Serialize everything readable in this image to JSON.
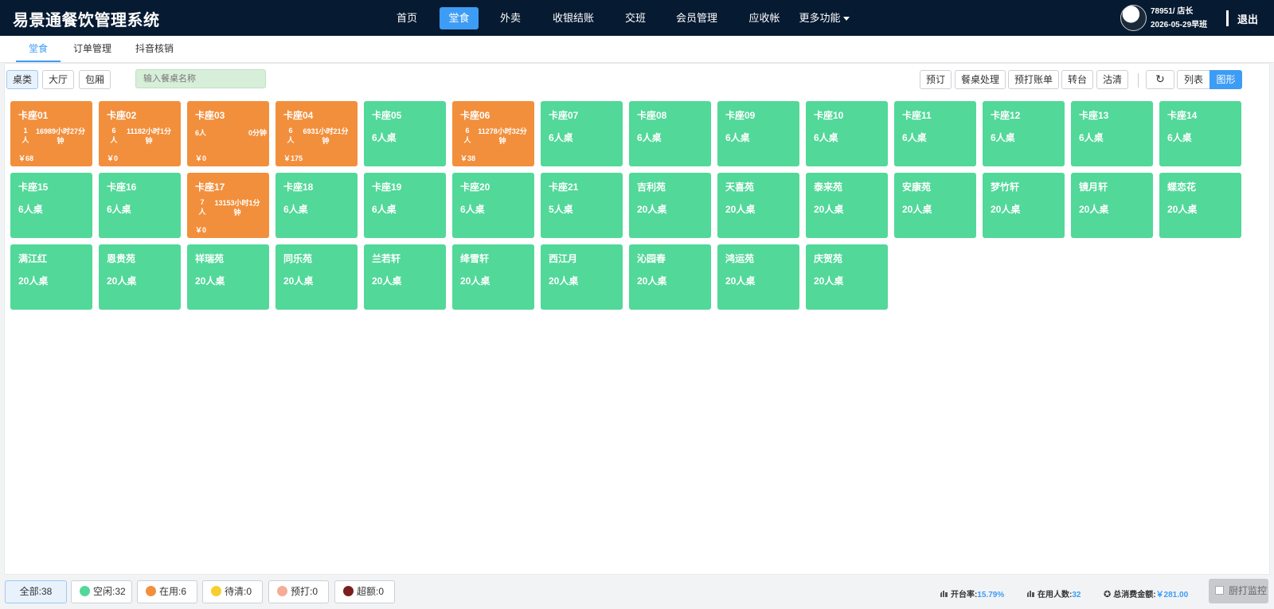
{
  "header": {
    "brand": "易景通餐饮管理系统",
    "nav": [
      {
        "label": "首页"
      },
      {
        "label": "堂食",
        "active": true
      },
      {
        "label": "外卖"
      },
      {
        "label": "收银结账"
      },
      {
        "label": "交班"
      },
      {
        "label": "会员管理"
      },
      {
        "label": "应收帐"
      },
      {
        "label": "更多功能"
      }
    ],
    "user_line1": "78951/ 店长",
    "user_line2": "2026-05-29早班",
    "logout": "退出"
  },
  "subtabs": [
    "堂食",
    "订单管理",
    "抖音核销"
  ],
  "toolbar": {
    "filters": [
      "桌类",
      "大厅",
      "包厢"
    ],
    "search_placeholder": "输入餐桌名称",
    "actions": [
      "预订",
      "餐桌处理",
      "预打账单",
      "转台",
      "沽清"
    ],
    "refresh_icon": "↻",
    "view_list": "列表",
    "view_graphic": "图形"
  },
  "tables": [
    {
      "name": "卡座01",
      "status": "busy",
      "people": "1\n人",
      "duration": "16989小时27分\n钟",
      "amount": "￥68"
    },
    {
      "name": "卡座02",
      "status": "busy",
      "people": "6\n人",
      "duration": "11182小时1分\n钟",
      "amount": "￥0"
    },
    {
      "name": "卡座03",
      "status": "busy",
      "people": "6人",
      "duration": "0分钟",
      "amount": "￥0",
      "inline": true
    },
    {
      "name": "卡座04",
      "status": "busy",
      "people": "6\n人",
      "duration": "6931小时21分\n钟",
      "amount": "￥175"
    },
    {
      "name": "卡座05",
      "status": "free",
      "capacity": "6人桌"
    },
    {
      "name": "卡座06",
      "status": "busy",
      "people": "6\n人",
      "duration": "11278小时32分\n钟",
      "amount": "￥38"
    },
    {
      "name": "卡座07",
      "status": "free",
      "capacity": "6人桌"
    },
    {
      "name": "卡座08",
      "status": "free",
      "capacity": "6人桌"
    },
    {
      "name": "卡座09",
      "status": "free",
      "capacity": "6人桌"
    },
    {
      "name": "卡座10",
      "status": "free",
      "capacity": "6人桌"
    },
    {
      "name": "卡座11",
      "status": "free",
      "capacity": "6人桌"
    },
    {
      "name": "卡座12",
      "status": "free",
      "capacity": "6人桌"
    },
    {
      "name": "卡座13",
      "status": "free",
      "capacity": "6人桌"
    },
    {
      "name": "卡座14",
      "status": "free",
      "capacity": "6人桌"
    },
    {
      "name": "卡座15",
      "status": "free",
      "capacity": "6人桌"
    },
    {
      "name": "卡座16",
      "status": "free",
      "capacity": "6人桌"
    },
    {
      "name": "卡座17",
      "status": "busy",
      "people": "7\n人",
      "duration": "13153小时1分\n钟",
      "amount": "￥0"
    },
    {
      "name": "卡座18",
      "status": "free",
      "capacity": "6人桌"
    },
    {
      "name": "卡座19",
      "status": "free",
      "capacity": "6人桌"
    },
    {
      "name": "卡座20",
      "status": "free",
      "capacity": "6人桌"
    },
    {
      "name": "卡座21",
      "status": "free",
      "capacity": "5人桌"
    },
    {
      "name": "吉利苑",
      "status": "free",
      "capacity": "20人桌"
    },
    {
      "name": "天喜苑",
      "status": "free",
      "capacity": "20人桌"
    },
    {
      "name": "泰来苑",
      "status": "free",
      "capacity": "20人桌"
    },
    {
      "name": "安康苑",
      "status": "free",
      "capacity": "20人桌"
    },
    {
      "name": "梦竹轩",
      "status": "free",
      "capacity": "20人桌"
    },
    {
      "name": "镜月轩",
      "status": "free",
      "capacity": "20人桌"
    },
    {
      "name": "蝶恋花",
      "status": "free",
      "capacity": "20人桌"
    },
    {
      "name": "满江红",
      "status": "free",
      "capacity": "20人桌"
    },
    {
      "name": "恩贵苑",
      "status": "free",
      "capacity": "20人桌"
    },
    {
      "name": "祥瑞苑",
      "status": "free",
      "capacity": "20人桌"
    },
    {
      "name": "同乐苑",
      "status": "free",
      "capacity": "20人桌"
    },
    {
      "name": "兰若轩",
      "status": "free",
      "capacity": "20人桌"
    },
    {
      "name": "绛雪轩",
      "status": "free",
      "capacity": "20人桌"
    },
    {
      "name": "西江月",
      "status": "free",
      "capacity": "20人桌"
    },
    {
      "name": "沁园春",
      "status": "free",
      "capacity": "20人桌"
    },
    {
      "name": "鸿运苑",
      "status": "free",
      "capacity": "20人桌"
    },
    {
      "name": "庆贺苑",
      "status": "free",
      "capacity": "20人桌"
    }
  ],
  "footer": {
    "chips": [
      {
        "label": "全部:38",
        "active": true
      },
      {
        "label": "空闲:32",
        "color": "#52d899"
      },
      {
        "label": "在用:6",
        "color": "#f28f3c"
      },
      {
        "label": "待清:0",
        "color": "#f5d02c"
      },
      {
        "label": "预打:0",
        "color": "#f5ad98"
      },
      {
        "label": "超额:0",
        "color": "#7a1e1e"
      }
    ],
    "stats": {
      "rate_label": "开台率:",
      "rate_value": "15.79%",
      "people_label": "在用人数:",
      "people_value": "32",
      "total_label": "总消费金额:",
      "total_value": "￥281.00"
    },
    "monitor": "厨打监控"
  },
  "colors": {
    "header_bg": "#061a31",
    "accent": "#3d9cf5",
    "free": "#52d899",
    "busy": "#f28f3c"
  }
}
